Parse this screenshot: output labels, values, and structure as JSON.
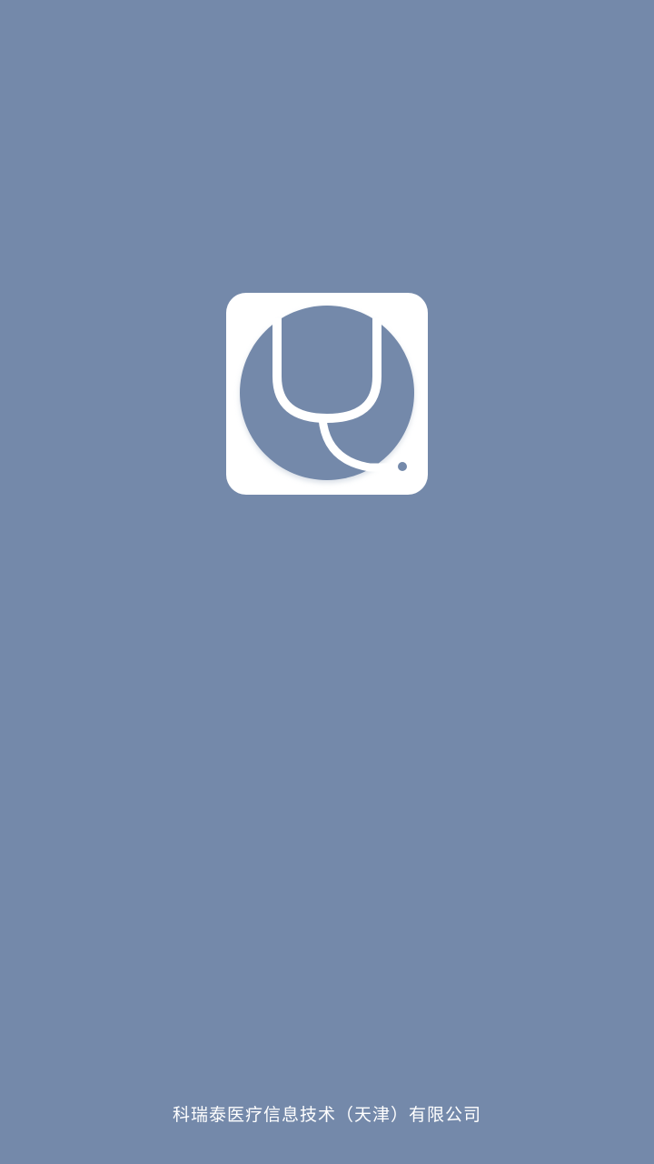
{
  "splash": {
    "background_color": "#7489aa",
    "logo": {
      "icon": "stethoscope-icon",
      "tile_color": "#ffffff",
      "accent_color": "#7489aa"
    },
    "footer": {
      "company_name": "科瑞泰医疗信息技术（天津）有限公司"
    }
  }
}
